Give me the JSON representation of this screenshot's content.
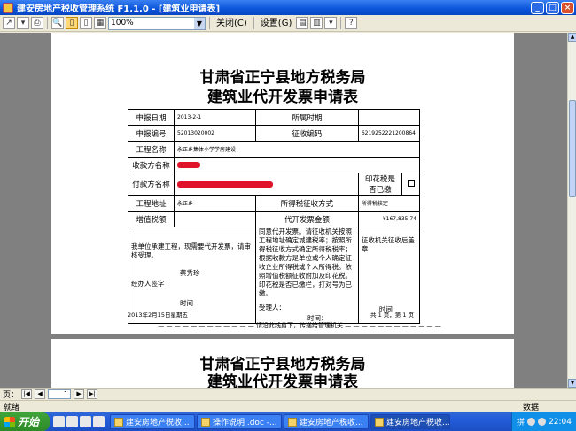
{
  "window": {
    "title": "建安房地产税收管理系统 F1.1.0 - [建筑业申请表]",
    "controls": [
      "_",
      "□",
      "×"
    ]
  },
  "toolbar": {
    "zoom_value": "100%",
    "close_label": "关闭(C)",
    "setup_label": "设置(G)"
  },
  "document": {
    "title_line1": "甘肃省正宁县地方税务局",
    "title_line2": "建筑业代开发票申请表",
    "rows": {
      "apply_date_label": "申报日期",
      "apply_date_value": "2013-2-1",
      "period_label": "所属时期",
      "apply_no_label": "申报编号",
      "apply_no_value": "52013020002",
      "collect_no_label": "征收编码",
      "collect_no_value": "6219252221200864",
      "project_name_label": "工程名称",
      "project_name_value": "永正乡集体小学学房建设",
      "payee_label": "收款方名称",
      "payer_label": "付款方名称",
      "stamp_label": "印花税是否已缴",
      "project_addr_label": "工程地址",
      "project_addr_value": "永正乡",
      "income_tax_label": "所得税征收方式",
      "income_tax_value": "所得税核定",
      "tax_amount_label": "增值税额",
      "invoice_amount_label": "代开发票金额",
      "invoice_amount_value": "¥167,835.74"
    },
    "section_left": "我单位承建工程，现需要代开发票，请审核受理。",
    "section_left_sig": "经办人签字",
    "section_left_name": "蔡秀珍",
    "section_left_time": "时间",
    "section_mid": "同意代开发票。请征收机关按照工程地址确定城建税率；按照所得税征收方式确定所得税税率；根据收款方是单位或个人确定征收企业所得税或个人所得税。依照增值税额征收附加及印花税。印花税是否已缴栏，打对号为已缴。",
    "section_mid_sig": "受理人：",
    "section_mid_time": "时间：",
    "section_right": "征收机关征收后盖章",
    "section_right_time": "时间",
    "footer_date": "2013年2月15日星期五",
    "footer_page": "共 1 页，第 1 页",
    "cut_text": "— — — — — — — — — — — — 请沿此线剪下，传递给管理机关 — — — — — — — — — — — —",
    "page2_title_line1": "甘肃省正宁县地方税务局",
    "page2_title_line2": "建筑业代开发票申请表"
  },
  "pagenav": {
    "label": "页：",
    "current_page": "1"
  },
  "statusbar": {
    "left": "就绪",
    "right": "数据"
  },
  "taskbar": {
    "start_label": "开始",
    "tasks": [
      "建安房地产税收...",
      "操作说明 .doc -...",
      "建安房地产税收...",
      "建安房地产税收..."
    ],
    "tray_label": "拼",
    "clock": "22:04"
  }
}
